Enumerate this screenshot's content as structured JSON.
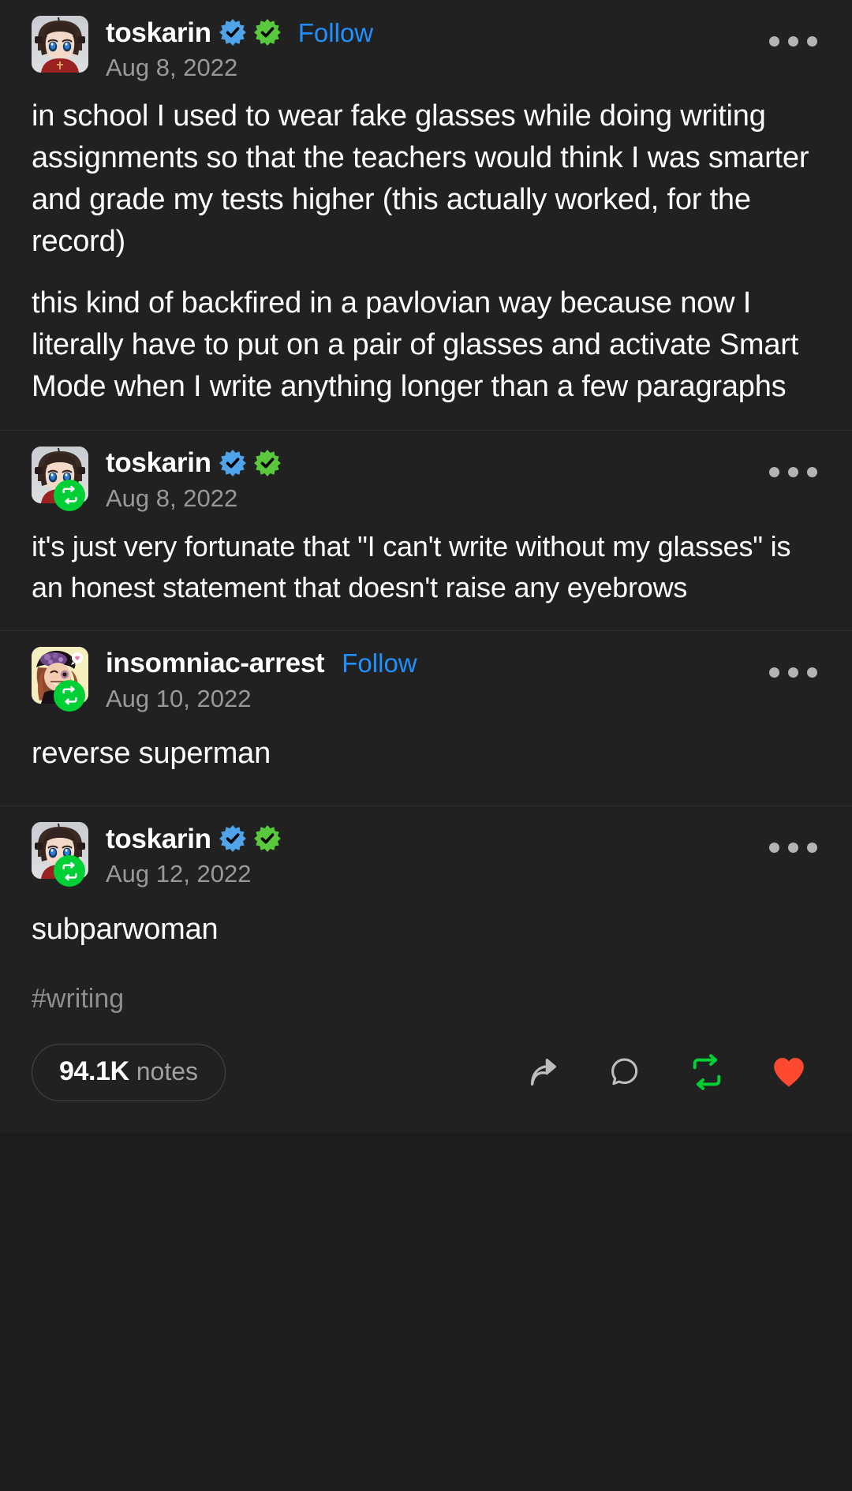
{
  "app": "tumblr-post-thread",
  "theme": {
    "background": "#1c1c1c",
    "post_background": "#212121",
    "text": "#ffffff",
    "muted": "#999999",
    "link": "#1e90ff",
    "verified_blue": "#4fa3e8",
    "verified_green": "#5ac83c",
    "reblog_green": "#00cf35",
    "like_red": "#ff4930",
    "divider": "#2e2e2e"
  },
  "posts": [
    {
      "username": "toskarin",
      "date": "Aug 8, 2022",
      "follow_label": "Follow",
      "show_follow": true,
      "is_reblog": false,
      "verified_blue": true,
      "verified_green": true,
      "paragraphs": [
        "in school I used to wear fake glasses while doing writing assignments so that the teachers would think I was smarter and grade my tests higher (this actually worked, for the record)",
        "this kind of backfired in a pavlovian way because now I literally have to put on a pair of glasses and activate Smart Mode when I write anything longer than a few paragraphs"
      ]
    },
    {
      "username": "toskarin",
      "date": "Aug 8, 2022",
      "follow_label": "",
      "show_follow": false,
      "is_reblog": true,
      "verified_blue": true,
      "verified_green": true,
      "paragraphs": [
        "it's just very fortunate that \"I can't write without my glasses\" is an honest statement that doesn't raise any eyebrows"
      ]
    },
    {
      "username": "insomniac-arrest",
      "date": "Aug 10, 2022",
      "follow_label": "Follow",
      "show_follow": true,
      "is_reblog": true,
      "verified_blue": false,
      "verified_green": false,
      "paragraphs": [
        "reverse superman"
      ]
    },
    {
      "username": "toskarin",
      "date": "Aug 12, 2022",
      "follow_label": "",
      "show_follow": false,
      "is_reblog": true,
      "verified_blue": true,
      "verified_green": true,
      "paragraphs": [
        "subparwoman"
      ]
    }
  ],
  "tags": [
    "#writing"
  ],
  "footer": {
    "notes_count": "94.1K",
    "notes_label": "notes",
    "actions": [
      {
        "name": "share-icon",
        "state": "default"
      },
      {
        "name": "reply-icon",
        "state": "default"
      },
      {
        "name": "reblog-icon",
        "state": "active"
      },
      {
        "name": "like-icon",
        "state": "liked"
      }
    ]
  },
  "icons": {
    "meatball": "more-options-icon",
    "reblog_badge": "reblog-badge-icon",
    "verified_blue": "verified-blue-icon",
    "verified_green": "verified-green-icon"
  }
}
